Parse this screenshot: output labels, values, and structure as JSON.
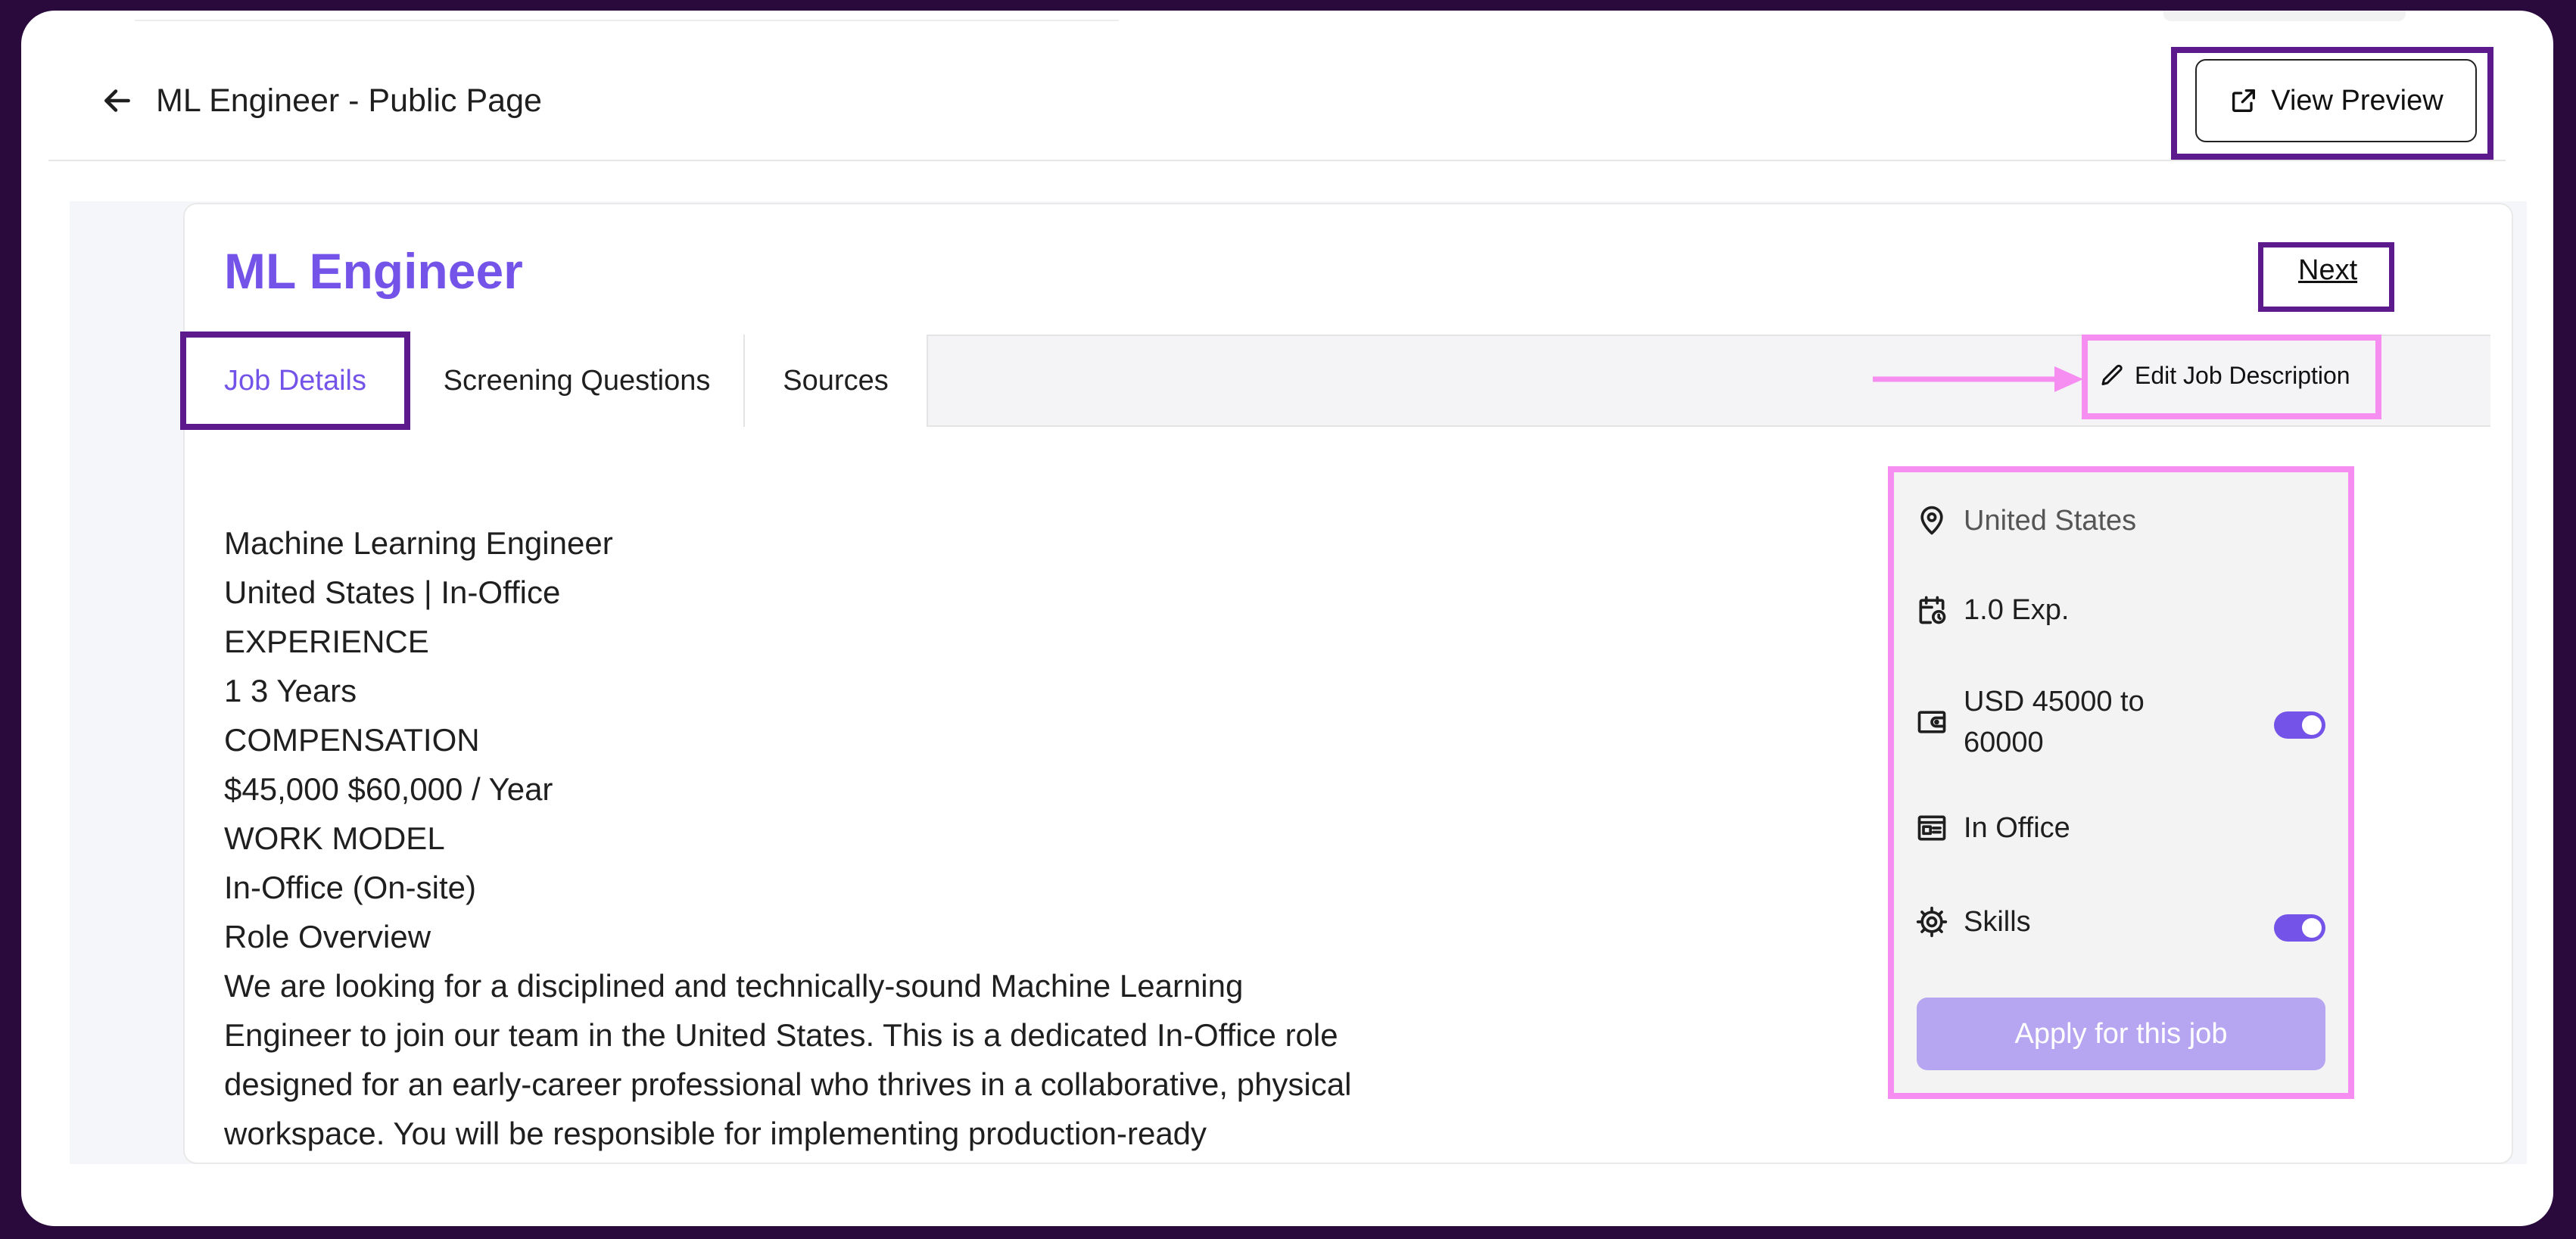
{
  "header": {
    "title": "ML Engineer - Public Page",
    "preview_label": "View Preview"
  },
  "job": {
    "title": "ML Engineer",
    "next_label": "Next"
  },
  "tabs": [
    {
      "label": "Job Details",
      "active": true
    },
    {
      "label": "Screening Questions",
      "active": false
    },
    {
      "label": "Sources",
      "active": false
    }
  ],
  "edit_label": "Edit Job Description",
  "description": {
    "lines": [
      "Machine Learning Engineer",
      "United States | In-Office",
      "EXPERIENCE",
      "1 3 Years",
      "COMPENSATION",
      "$45,000 $60,000 / Year",
      "WORK MODEL",
      "In-Office (On-site)",
      "Role Overview"
    ],
    "overview": "We are looking for a disciplined and technically-sound Machine Learning Engineer to join our team in the United States. This is a dedicated In-Office role designed for an early-career professional who thrives in a collaborative, physical workspace. You will be responsible for implementing production-ready"
  },
  "sidebar": {
    "location": "United States",
    "experience": "1.0 Exp.",
    "salary_line1": "USD 45000 to",
    "salary_line2": "60000",
    "salary_visible": true,
    "work_model": "In Office",
    "skills": "Skills",
    "skills_visible": true,
    "apply_label": "Apply for this job"
  },
  "colors": {
    "accent": "#7454e8",
    "highlight_dark": "#5c1a8c",
    "highlight_pink": "#f58ef0",
    "apply_disabled": "#b6a5f0"
  },
  "icons": {
    "back": "arrow-left-icon",
    "preview": "external-link-icon",
    "edit": "pencil-icon",
    "location": "map-pin-icon",
    "experience": "calendar-clock-icon",
    "salary": "wallet-icon",
    "work_model": "office-id-icon",
    "skills": "gear-icon"
  }
}
